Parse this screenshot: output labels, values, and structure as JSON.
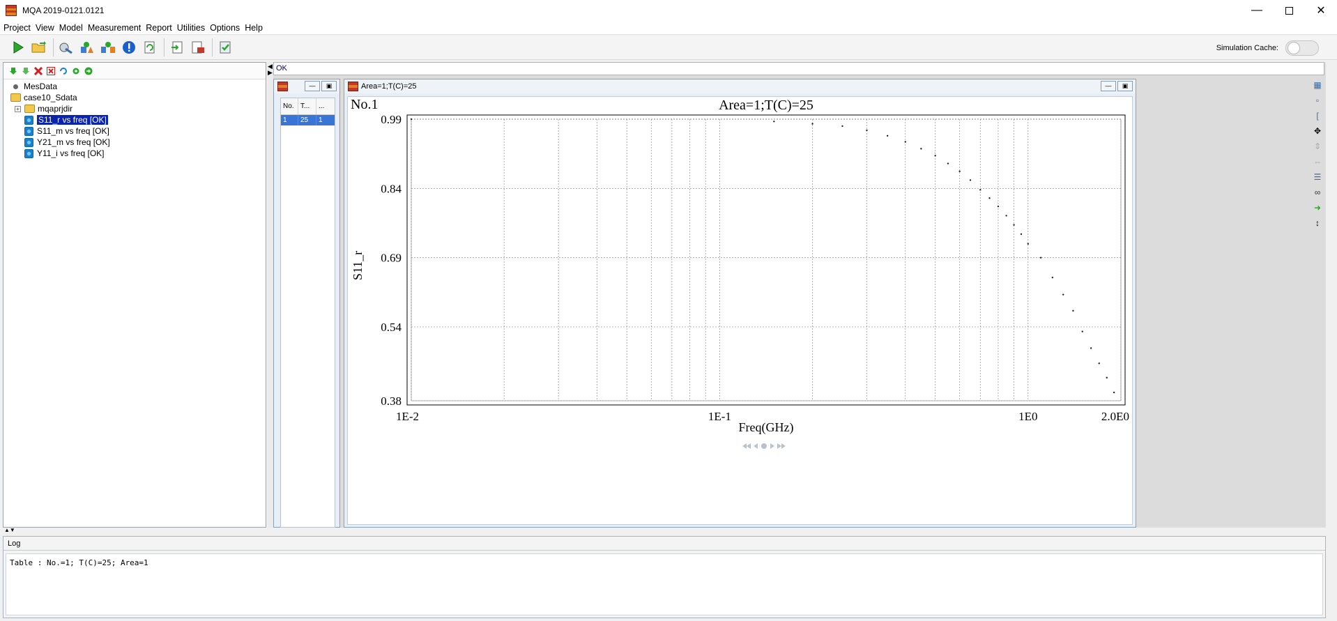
{
  "window": {
    "title": "MQA 2019-0121.0121"
  },
  "menu": [
    "Project",
    "View",
    "Model",
    "Measurement",
    "Report",
    "Utilities",
    "Options",
    "Help"
  ],
  "toolbar": {
    "simulation_cache_label": "Simulation Cache:",
    "simulation_cache_on": false
  },
  "tree": {
    "root": "MesData",
    "project": "case10_Sdata",
    "subfolder": "mqaprjdir",
    "items": [
      "S11_r vs freq [OK]",
      "S11_m vs freq [OK]",
      "Y21_m vs freq [OK]",
      "Y11_i vs freq [OK]"
    ],
    "selected_index": 0
  },
  "status": {
    "text": "OK"
  },
  "table_window": {
    "headers": [
      "No.",
      "T...",
      "..."
    ],
    "rows": [
      [
        "1",
        "25",
        "1"
      ]
    ]
  },
  "chart_window": {
    "title": "Area=1;T(C)=25"
  },
  "chart_data": {
    "type": "scatter",
    "panel_label": "No.1",
    "title": "Area=1;T(C)=25",
    "xlabel": "Freq(GHz)",
    "ylabel": "S11_r",
    "x_scale": "log",
    "xlim": [
      0.01,
      2.0
    ],
    "ylim": [
      0.38,
      0.99
    ],
    "x_tick_labels": [
      "1E-2",
      "1E-1",
      "1E0",
      "2.0E0"
    ],
    "x_ticks": [
      0.01,
      0.1,
      1.0,
      2.0
    ],
    "y_tick_labels": [
      "0.99",
      "0.84",
      "0.69",
      "0.54",
      "0.38"
    ],
    "y_ticks": [
      0.99,
      0.84,
      0.69,
      0.54,
      0.38
    ],
    "grid": true,
    "series": [
      {
        "x": [
          0.01,
          0.15,
          0.2,
          0.25,
          0.3,
          0.35,
          0.4,
          0.45,
          0.5,
          0.55,
          0.6,
          0.65,
          0.7,
          0.75,
          0.8,
          0.85,
          0.9,
          0.95,
          1.0,
          1.1,
          1.2,
          1.3,
          1.4,
          1.5,
          1.6,
          1.7,
          1.8,
          1.9
        ],
        "y": [
          0.99,
          0.985,
          0.98,
          0.975,
          0.966,
          0.954,
          0.941,
          0.926,
          0.911,
          0.894,
          0.877,
          0.858,
          0.837,
          0.819,
          0.801,
          0.781,
          0.761,
          0.741,
          0.72,
          0.69,
          0.647,
          0.61,
          0.575,
          0.53,
          0.494,
          0.461,
          0.43,
          0.398
        ]
      }
    ]
  },
  "log": {
    "tab_label": "Log",
    "text": "Table : No.=1; T(C)=25; Area=1"
  },
  "colors": {
    "selection": "#0a24b0",
    "table_selection": "#3875d7",
    "status_text": "#000080"
  }
}
